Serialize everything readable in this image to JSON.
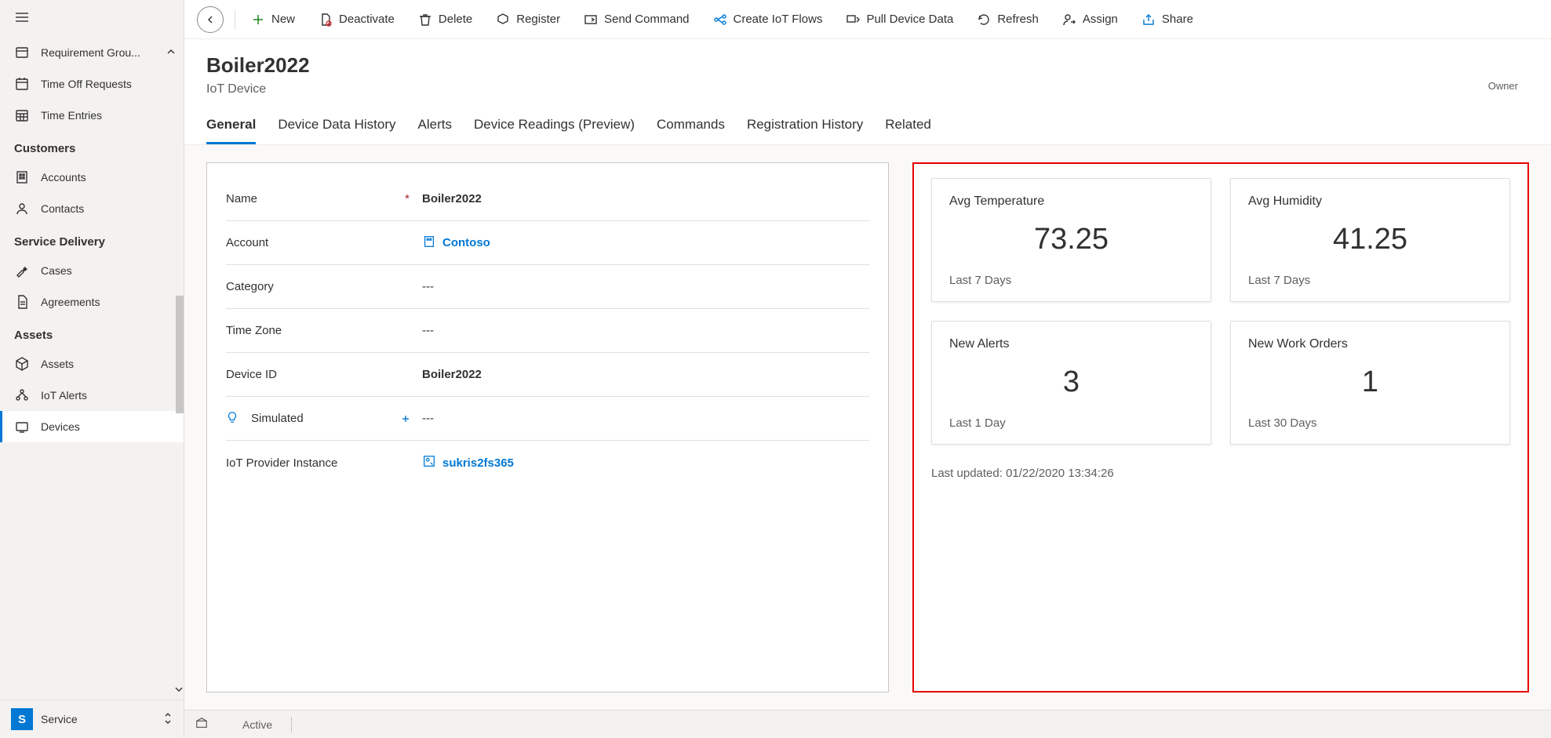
{
  "sidebar": {
    "items_top": [
      {
        "label": "Requirement Grou..."
      },
      {
        "label": "Time Off Requests"
      },
      {
        "label": "Time Entries"
      }
    ],
    "sections": [
      {
        "header": "Customers",
        "items": [
          {
            "label": "Accounts"
          },
          {
            "label": "Contacts"
          }
        ]
      },
      {
        "header": "Service Delivery",
        "items": [
          {
            "label": "Cases"
          },
          {
            "label": "Agreements"
          }
        ]
      },
      {
        "header": "Assets",
        "items": [
          {
            "label": "Assets"
          },
          {
            "label": "IoT Alerts"
          },
          {
            "label": "Devices"
          }
        ]
      }
    ],
    "footer_badge": "S",
    "footer_label": "Service"
  },
  "commandbar": {
    "new": "New",
    "deactivate": "Deactivate",
    "delete": "Delete",
    "register": "Register",
    "send_command": "Send Command",
    "create_flows": "Create IoT Flows",
    "pull_data": "Pull Device Data",
    "refresh": "Refresh",
    "assign": "Assign",
    "share": "Share"
  },
  "header": {
    "title": "Boiler2022",
    "subtitle": "IoT Device",
    "owner_label": "Owner"
  },
  "tabs": {
    "general": "General",
    "history": "Device Data History",
    "alerts": "Alerts",
    "readings": "Device Readings (Preview)",
    "commands": "Commands",
    "reg_history": "Registration History",
    "related": "Related"
  },
  "fields": {
    "name_label": "Name",
    "name_value": "Boiler2022",
    "account_label": "Account",
    "account_value": "Contoso",
    "category_label": "Category",
    "category_value": "---",
    "timezone_label": "Time Zone",
    "timezone_value": "---",
    "deviceid_label": "Device ID",
    "deviceid_value": "Boiler2022",
    "simulated_label": "Simulated",
    "simulated_value": "---",
    "provider_label": "IoT Provider Instance",
    "provider_value": "sukris2fs365"
  },
  "cards": {
    "temp_title": "Avg Temperature",
    "temp_value": "73.25",
    "temp_footer": "Last 7 Days",
    "humidity_title": "Avg Humidity",
    "humidity_value": "41.25",
    "humidity_footer": "Last 7 Days",
    "alerts_title": "New Alerts",
    "alerts_value": "3",
    "alerts_footer": "Last 1 Day",
    "workorders_title": "New Work Orders",
    "workorders_value": "1",
    "workorders_footer": "Last 30 Days",
    "last_updated": "Last updated: 01/22/2020 13:34:26"
  },
  "statusbar": {
    "status": "Active"
  }
}
